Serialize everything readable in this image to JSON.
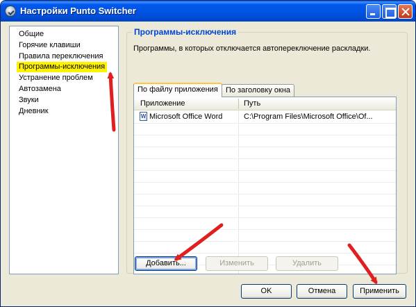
{
  "window": {
    "title": "Настройки Punto Switcher"
  },
  "sidebar": {
    "items": [
      {
        "label": "Общие"
      },
      {
        "label": "Горячие клавиши"
      },
      {
        "label": "Правила переключения"
      },
      {
        "label": "Программы-исключения",
        "selected": true
      },
      {
        "label": "Устранение проблем"
      },
      {
        "label": "Автозамена"
      },
      {
        "label": "Звуки"
      },
      {
        "label": "Дневник"
      }
    ],
    "highlight_color": "#fff200"
  },
  "panel": {
    "title": "Программы-исключения",
    "description": "Программы, в которых отключается автопереключение раскладки.",
    "tabs": [
      {
        "label": "По файлу приложения",
        "active": true
      },
      {
        "label": "По заголовку окна",
        "active": false
      }
    ],
    "table": {
      "columns": [
        "Приложение",
        "Путь"
      ],
      "rows": [
        {
          "app": "Microsoft Office Word",
          "path": "C:\\Program Files\\Microsoft Office\\Of...",
          "icon": "word-document-icon"
        }
      ]
    },
    "buttons": {
      "add": "Добавить...",
      "edit": "Изменить",
      "delete": "Удалить"
    }
  },
  "footer": {
    "ok": "OK",
    "cancel": "Отмена",
    "apply": "Применить"
  },
  "annotation_color": "#e02020"
}
